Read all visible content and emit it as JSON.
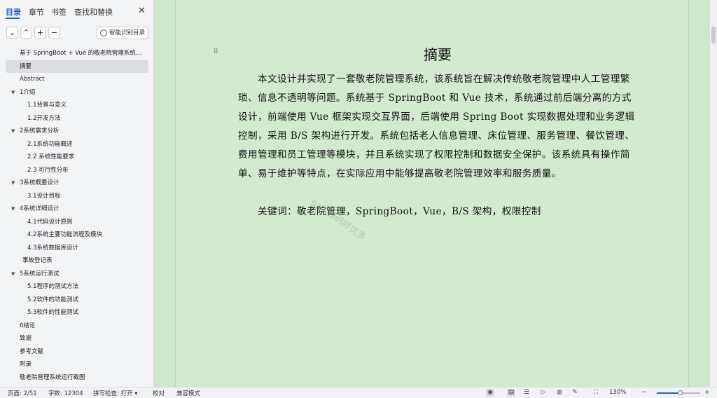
{
  "sidebar": {
    "tabs": [
      {
        "label": "目录",
        "active": true
      },
      {
        "label": "章节",
        "active": false
      },
      {
        "label": "书签",
        "active": false
      },
      {
        "label": "查找和替换",
        "active": false
      }
    ],
    "close_icon": "close-icon",
    "smart_button": "智能识别目录",
    "toc": [
      {
        "label": "基于 SpringBoot + Vue 的敬老院管理系统的设计与实现",
        "level": 0
      },
      {
        "label": "摘要",
        "level": 0,
        "selected": true
      },
      {
        "label": "Abstract",
        "level": 0
      },
      {
        "label": "1介绍",
        "level": 0,
        "expanded": true
      },
      {
        "label": "1.1背景与意义",
        "level": 1
      },
      {
        "label": "1.2开发方法",
        "level": 1
      },
      {
        "label": "2系统需求分析",
        "level": 0,
        "expanded": true
      },
      {
        "label": "2.1系统功能概述",
        "level": 1
      },
      {
        "label": "2.2  系统性能要求",
        "level": 1
      },
      {
        "label": "2.3  可行性分析",
        "level": 1
      },
      {
        "label": "3系统概要设计",
        "level": 0,
        "expanded": true
      },
      {
        "label": "3.1设计目标",
        "level": 1
      },
      {
        "label": "4系统详细设计",
        "level": 0,
        "expanded": true
      },
      {
        "label": "4.1代码设计原则",
        "level": 1
      },
      {
        "label": "4.2系统主要功能流程及模块",
        "level": 1
      },
      {
        "label": "4.3系统数据库设计",
        "level": 1
      },
      {
        "label": "事故登记表",
        "level": 0,
        "indent_small": true
      },
      {
        "label": "5系统运行测试",
        "level": 0,
        "expanded": true
      },
      {
        "label": "5.1程序的测试方法",
        "level": 1
      },
      {
        "label": "5.2软件的功能测试",
        "level": 1
      },
      {
        "label": "5.3软件的性能测试",
        "level": 1
      },
      {
        "label": "6结论",
        "level": 0
      },
      {
        "label": "致谢",
        "level": 0
      },
      {
        "label": "参考文献",
        "level": 0
      },
      {
        "label": "附录",
        "level": 0
      },
      {
        "label": "敬老院管理系统运行截图",
        "level": 0
      }
    ]
  },
  "document": {
    "title": "摘要",
    "body": "本文设计并实现了一套敬老院管理系统，该系统旨在解决传统敬老院管理中人工管理繁琐、信息不透明等问题。系统基于 SpringBoot 和 Vue 技术，系统通过前后端分离的方式设计，前端使用 Vue 框架实现交互界面，后端使用 Spring Boot 实现数据处理和业务逻辑控制，采用 B/S 架构进行开发。系统包括老人信息管理、床位管理、服务管理、餐饮管理、费用管理和员工管理等模块，并且系统实现了权限控制和数据安全保护。该系统具有操作简单、易于维护等特点，在实际应用中能够提高敬老院管理效率和服务质量。",
    "keywords": "关键词：敬老院管理，SpringBoot，Vue，B/S 架构，权限控制",
    "watermark": "gzh 源码好优多"
  },
  "status": {
    "page": "页面: 2/51",
    "words": "字数: 12304",
    "spellcheck": "拼写检查: 打开",
    "proof": "校对",
    "compat": "兼容模式",
    "zoom": "130%",
    "zoom_fraction": 0.55
  }
}
